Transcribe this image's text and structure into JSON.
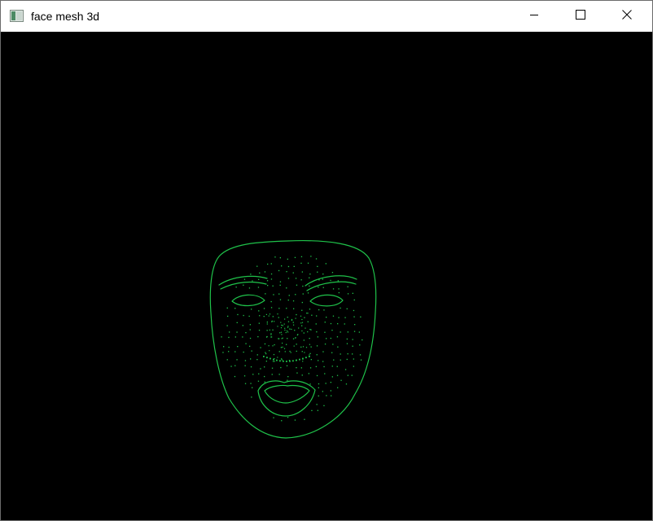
{
  "window": {
    "title": "face mesh 3d",
    "icon": "application-window-icon",
    "controls": {
      "minimize": "minimize-icon",
      "maximize": "maximize-icon",
      "close": "close-icon"
    }
  },
  "canvas": {
    "background": "#000000",
    "mesh_color": "#1fc24a",
    "content": "face-mesh-wireframe"
  }
}
